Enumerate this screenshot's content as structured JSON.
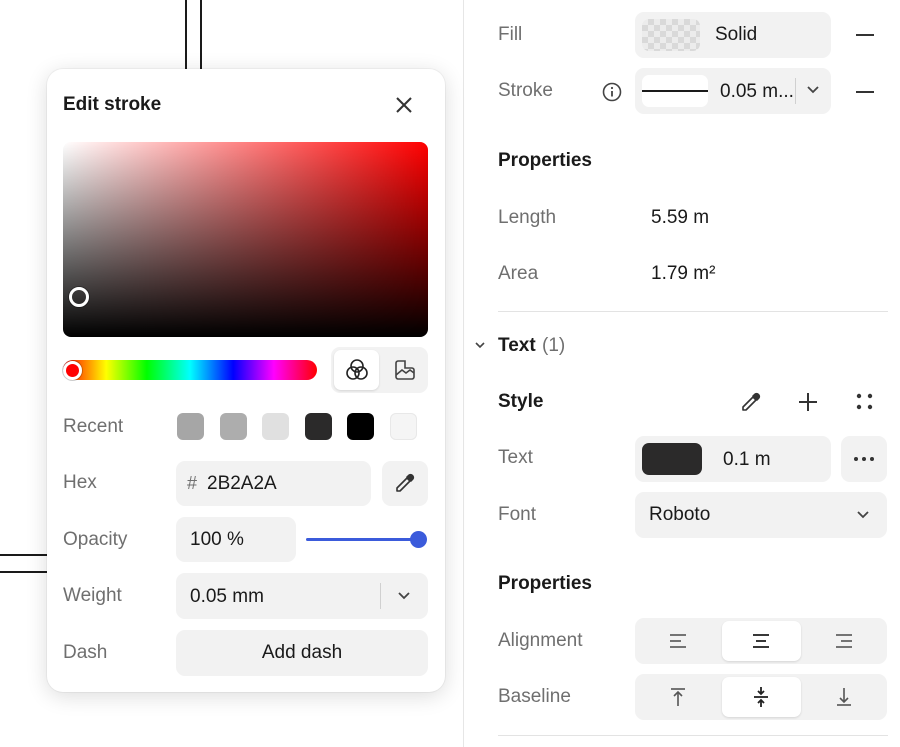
{
  "popover": {
    "title": "Edit stroke",
    "recent_label": "Recent",
    "recent_swatches": [
      "#a6a6a6",
      "#adadad",
      "#e0e0e0",
      "#2b2a2a",
      "#000000",
      "#f5f5f5"
    ],
    "hex_label": "Hex",
    "hex_prefix": "#",
    "hex_value": "2B2A2A",
    "opacity_label": "Opacity",
    "opacity_value": "100 %",
    "opacity_fraction": 1.0,
    "weight_label": "Weight",
    "weight_value": "0.05 mm",
    "dash_label": "Dash",
    "add_dash_label": "Add dash",
    "accent_color": "#3b5bdb"
  },
  "panel": {
    "fill_label": "Fill",
    "fill_value": "Solid",
    "stroke_label": "Stroke",
    "stroke_value": "0.05 m...",
    "properties_heading": "Properties",
    "length_label": "Length",
    "length_value": "5.59 m",
    "area_label": "Area",
    "area_value": "1.79 m²",
    "text_section_label": "Text",
    "text_section_count": "(1)",
    "style_heading": "Style",
    "text_label": "Text",
    "text_size_value": "0.1 m",
    "text_color": "#2b2a2a",
    "font_label": "Font",
    "font_value": "Roboto",
    "properties2_heading": "Properties",
    "alignment_label": "Alignment",
    "baseline_label": "Baseline"
  }
}
